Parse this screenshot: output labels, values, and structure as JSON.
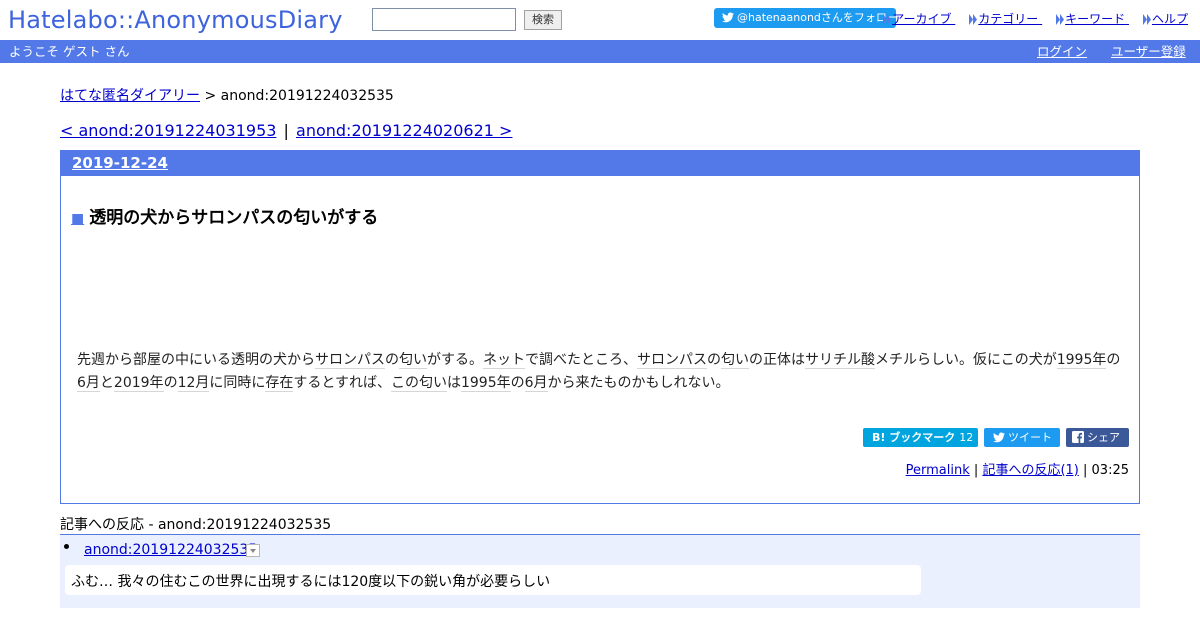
{
  "header": {
    "logo": "Hatelabo::AnonymousDiary",
    "search_placeholder": "",
    "search_button": "検索",
    "follow_button": "@hatenaanondさんをフォロー",
    "nav_links": [
      "アーカイブ",
      "カテゴリー",
      "キーワード",
      "ヘルプ"
    ]
  },
  "welcome_bar": {
    "greeting": "ようこそ ゲスト さん",
    "login": "ログイン",
    "register": "ユーザー登録"
  },
  "breadcrumb": {
    "home": "はてな匿名ダイアリー",
    "separator": ">",
    "current": "anond:20191224032535"
  },
  "pager": {
    "prev": "< anond:20191224031953",
    "separator": "|",
    "next": "anond:20191224020621 >"
  },
  "entry": {
    "date": "2019-12-24",
    "title_marker": "■",
    "title": "透明の犬からサロンパスの匂いがする",
    "body_segments": [
      "先週から部屋の中にいる透明の犬から",
      "サロンパス",
      "の",
      "匂い",
      "がする。",
      "ネット",
      "で調べたところ、",
      "サロンパス",
      "の",
      "匂い",
      "の正体は",
      "サリチル酸",
      "メチルらしい。仮にこの犬が",
      "1995年",
      "の",
      "6月",
      "と",
      "2019年",
      "の",
      "12月",
      "に同時に",
      "存在",
      "するとすれば、",
      "この",
      "匂い",
      "は",
      "1995年",
      "の",
      "6月",
      "から来たものかもしれない。"
    ],
    "share": {
      "bookmark_label": "B! ブックマーク",
      "bookmark_count": "12",
      "tweet_label": "ツイート",
      "facebook_label": "シェア"
    },
    "footer": {
      "permalink": "Permalink",
      "separator": "|",
      "reactions_link": "記事への反応(1)",
      "time": "03:25"
    }
  },
  "reactions": {
    "heading": "記事への反応 - anond:20191224032535",
    "items": [
      {
        "id": "anond:20191224032535",
        "text": "ふむ… 我々の住むこの世界に出現するには120度以下の鋭い角が必要らしい"
      }
    ]
  },
  "colors": {
    "brand_blue": "#5279e7",
    "link": "#0000cc",
    "twitter": "#1d9bf0",
    "hatena_bookmark": "#00a4de",
    "facebook": "#3b5998",
    "reaction_bg": "#eaf0fd"
  },
  "icons": {
    "twitter": "twitter-bird-icon",
    "facebook": "facebook-f-icon",
    "nav_arrow": "double-chevron-right-icon",
    "reaction_menu": "dropdown-triangle-icon"
  }
}
